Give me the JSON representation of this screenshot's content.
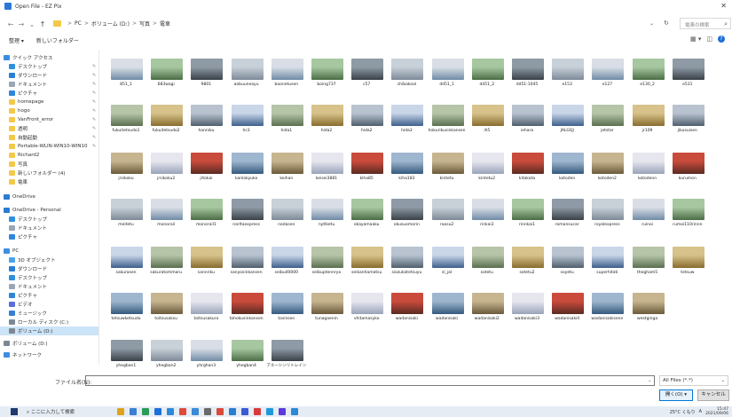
{
  "window": {
    "title": "Open File - EZ Pix",
    "close_glyph": "✕"
  },
  "address": {
    "back": "←",
    "forward": "→",
    "recent": "⌄",
    "up": "↑",
    "crumbs": [
      "PC",
      "ボリューム (D:)",
      "写真",
      "電車"
    ],
    "separator": ">",
    "dropdown": "⌄",
    "refresh": "↻",
    "search_placeholder": "電車の検索"
  },
  "toolbar": {
    "organize": "整理 ▾",
    "new_folder": "新しいフォルダー",
    "view_icon": "▦ ▾",
    "pane_icon": "◫",
    "help": "?"
  },
  "nav": [
    {
      "label": "クイック アクセス",
      "icon": "star-icon",
      "color": "#3b8ede",
      "indent": 0,
      "pinned": false
    },
    {
      "label": "デスクトップ",
      "icon": "desktop-icon",
      "color": "#2f8fdd",
      "indent": 1,
      "pinned": true
    },
    {
      "label": "ダウンロード",
      "icon": "download-icon",
      "color": "#2a7fd4",
      "indent": 1,
      "pinned": true
    },
    {
      "label": "ドキュメント",
      "icon": "document-icon",
      "color": "#9aa6b4",
      "indent": 1,
      "pinned": true
    },
    {
      "label": "ピクチャ",
      "icon": "picture-icon",
      "color": "#2d86d8",
      "indent": 1,
      "pinned": true
    },
    {
      "label": "homepage",
      "icon": "folder-icon",
      "color": "#f3c94b",
      "indent": 1,
      "pinned": true
    },
    {
      "label": "hogo",
      "icon": "folder-icon",
      "color": "#f3c94b",
      "indent": 1,
      "pinned": true
    },
    {
      "label": "VanFront_error",
      "icon": "folder-icon",
      "color": "#f3c94b",
      "indent": 1,
      "pinned": true
    },
    {
      "label": "透明",
      "icon": "folder-icon",
      "color": "#f3c94b",
      "indent": 1,
      "pinned": true
    },
    {
      "label": "自動起動",
      "icon": "folder-icon",
      "color": "#f3c94b",
      "indent": 1,
      "pinned": true
    },
    {
      "label": "Portable-WLIN-WIN10-WIN10",
      "icon": "folder-icon",
      "color": "#f3c94b",
      "indent": 1,
      "pinned": true
    },
    {
      "label": "Richard2",
      "icon": "folder-icon",
      "color": "#f3c94b",
      "indent": 1,
      "pinned": false
    },
    {
      "label": "写真",
      "icon": "folder-icon",
      "color": "#f3c94b",
      "indent": 1,
      "pinned": false
    },
    {
      "label": "新しいフォルダー (4)",
      "icon": "folder-icon",
      "color": "#f3c94b",
      "indent": 1,
      "pinned": false
    },
    {
      "label": "電車",
      "icon": "folder-icon",
      "color": "#f3c94b",
      "indent": 1,
      "pinned": false
    },
    {
      "label": "OneDrive",
      "icon": "cloud-icon",
      "color": "#2b7cd3",
      "indent": 0,
      "pinned": false
    },
    {
      "label": "OneDrive - Personal",
      "icon": "cloud-icon",
      "color": "#2b7cd3",
      "indent": 0,
      "pinned": false
    },
    {
      "label": "デスクトップ",
      "icon": "desktop-icon",
      "color": "#2f8fdd",
      "indent": 1,
      "pinned": false
    },
    {
      "label": "ドキュメント",
      "icon": "document-icon",
      "color": "#9aa6b4",
      "indent": 1,
      "pinned": false
    },
    {
      "label": "ピクチャ",
      "icon": "picture-icon",
      "color": "#2d86d8",
      "indent": 1,
      "pinned": false
    },
    {
      "label": "PC",
      "icon": "pc-icon",
      "color": "#3d8fe0",
      "indent": 0,
      "pinned": false
    },
    {
      "label": "3D オブジェクト",
      "icon": "cube-icon",
      "color": "#4aa3e8",
      "indent": 1,
      "pinned": false
    },
    {
      "label": "ダウンロード",
      "icon": "download-icon",
      "color": "#2a7fd4",
      "indent": 1,
      "pinned": false
    },
    {
      "label": "デスクトップ",
      "icon": "desktop-icon",
      "color": "#2f8fdd",
      "indent": 1,
      "pinned": false
    },
    {
      "label": "ドキュメント",
      "icon": "document-icon",
      "color": "#9aa6b4",
      "indent": 1,
      "pinned": false
    },
    {
      "label": "ピクチャ",
      "icon": "picture-icon",
      "color": "#2d86d8",
      "indent": 1,
      "pinned": false
    },
    {
      "label": "ビデオ",
      "icon": "video-icon",
      "color": "#5a6fd8",
      "indent": 1,
      "pinned": false
    },
    {
      "label": "ミュージック",
      "icon": "music-icon",
      "color": "#3a7fd0",
      "indent": 1,
      "pinned": false
    },
    {
      "label": "ローカル ディスク (C:)",
      "icon": "drive-icon",
      "color": "#7d8894",
      "indent": 1,
      "pinned": false
    },
    {
      "label": "ボリューム (D:)",
      "icon": "drive-icon",
      "color": "#7d8894",
      "indent": 1,
      "pinned": false,
      "selected": true
    },
    {
      "label": "ボリューム (D:)",
      "icon": "drive-icon",
      "color": "#7d8894",
      "indent": 0,
      "pinned": false
    },
    {
      "label": "ネットワーク",
      "icon": "network-icon",
      "color": "#3b8ede",
      "indent": 0,
      "pinned": false
    }
  ],
  "files": [
    [
      "851_1",
      "683wagi",
      "9801",
      "aobuuneayu",
      "baonetusen",
      "boing737",
      "c57",
      "chibakoal",
      "dd51_1",
      "dd51_2",
      "dd51-1045",
      "e153",
      "e127",
      "e130_2",
      "e531"
    ],
    [
      "fukuitetsudo1",
      "fukuitetsudo2",
      "hanniku",
      "hc3",
      "hida1",
      "hida2",
      "hida2",
      "hida3",
      "hokurikusinkansen",
      "ih5",
      "iehara",
      "JALGQJ",
      "jetstar",
      "jr109",
      "jikusuisen"
    ],
    [
      "jrsikoku",
      "jrsikoku2",
      "jrtokai",
      "kanlokyuko",
      "keihan",
      "keisei3881",
      "kiha85",
      "kiha183",
      "kintetu",
      "kintetu2",
      "kitakata",
      "kotoden",
      "kotoden2",
      "kotodenn",
      "kurumon"
    ],
    [
      "meitetu",
      "monorail",
      "monorail1",
      "narltaexpress",
      "nodasen",
      "nytlketu",
      "okayamaaku",
      "okusuomorin",
      "raosu2",
      "rinkai3",
      "rinnkai1",
      "romansucar",
      "royalexpress",
      "ruinoi",
      "rumoi110rinnn"
    ],
    [
      "sakurasen",
      "sakuratommaru",
      "sannriku",
      "sanyosinkansen",
      "seibu40000",
      "seibuptennryo",
      "seikanhamatsu",
      "siozukatetsuyu",
      "sl_jal",
      "sotetu",
      "sotetu2",
      "soyetu",
      "superhitati",
      "thegham5",
      "tetsuw"
    ],
    [
      "tetsuwketsudo",
      "toitsusaksu",
      "toitsusakura",
      "tohokusinkansen",
      "tosinsen",
      "tunagaenin",
      "vhitamasyko",
      "wadanisaki",
      "wadanisaki",
      "wadanisaki2",
      "wadanisaki3",
      "wadanisaki4",
      "wadanisakisenn",
      "westginga",
      ""
    ],
    [
      "yhegban1",
      "yhegban2",
      "yhrghan3",
      "yhegban4",
      "アルーシンリトレイン",
      "",
      "",
      "",
      "",
      "",
      "",
      "",
      "",
      "",
      ""
    ]
  ],
  "bottom": {
    "filename_label": "ファイル名(N):",
    "filename_value": "",
    "filter": "All Files (*.*)",
    "open": "開く(O)  ▾",
    "cancel": "キャンセル"
  },
  "taskbar": {
    "search_text": "ここに入力して検索",
    "weather": "25°C くもり",
    "ime": "A",
    "time": "15:47",
    "date": "2021/09/06"
  }
}
